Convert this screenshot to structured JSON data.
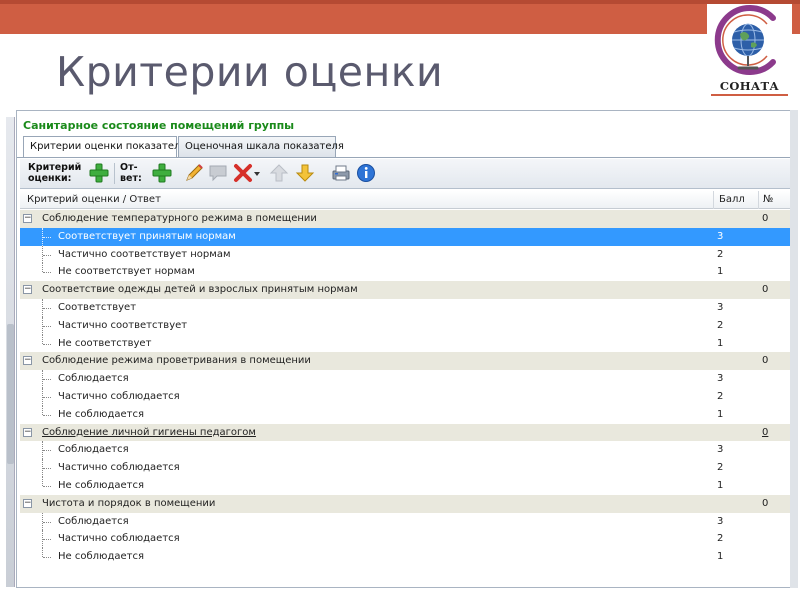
{
  "slide": {
    "title": "Критерии оценки",
    "logo_text": "СОНАТА"
  },
  "window": {
    "title": "Санитарное состояние помещений группы",
    "tabs": [
      {
        "label": "Критерии оценки показателя",
        "active": true
      },
      {
        "label": "Оценочная шкала показателя",
        "active": false
      }
    ]
  },
  "toolbar": {
    "criterion_label_line1": "Критерий",
    "criterion_label_line2": "оценки:",
    "answer_label_line1": "От-",
    "answer_label_line2": "вет:",
    "icons": [
      "add-criterion-icon",
      "add-answer-icon",
      "edit-pencil-icon",
      "comment-icon",
      "delete-icon",
      "dropdown-arrow-icon",
      "move-up-icon",
      "move-down-icon",
      "print-icon",
      "info-icon"
    ]
  },
  "grid": {
    "columns": {
      "criterion": "Критерий оценки / Ответ",
      "score": "Балл",
      "num": "№"
    },
    "groups": [
      {
        "name": "Соблюдение температурного режима в помещении",
        "num": "0",
        "underlined": false,
        "answers": [
          {
            "text": "Соответствует принятым нормам",
            "score": "3",
            "selected": true
          },
          {
            "text": "Частично соответствует нормам",
            "score": "2",
            "selected": false
          },
          {
            "text": "Не соответствует нормам",
            "score": "1",
            "selected": false
          }
        ]
      },
      {
        "name": "Соответствие одежды детей и взрослых принятым нормам",
        "num": "0",
        "underlined": false,
        "answers": [
          {
            "text": "Соответствует",
            "score": "3",
            "selected": false
          },
          {
            "text": "Частично соответствует",
            "score": "2",
            "selected": false
          },
          {
            "text": "Не соответствует",
            "score": "1",
            "selected": false
          }
        ]
      },
      {
        "name": "Соблюдение режима проветривания в помещении",
        "num": "0",
        "underlined": false,
        "answers": [
          {
            "text": "Соблюдается",
            "score": "3",
            "selected": false
          },
          {
            "text": "Частично соблюдается",
            "score": "2",
            "selected": false
          },
          {
            "text": "Не соблюдается",
            "score": "1",
            "selected": false
          }
        ]
      },
      {
        "name": "Соблюдение  личной гигиены педагогом",
        "num": "0",
        "underlined": true,
        "answers": [
          {
            "text": "Соблюдается",
            "score": "3",
            "selected": false
          },
          {
            "text": "Частично соблюдается",
            "score": "2",
            "selected": false
          },
          {
            "text": "Не соблюдается",
            "score": "1",
            "selected": false
          }
        ]
      },
      {
        "name": "Чистота и порядок в помещении",
        "num": "0",
        "underlined": false,
        "answers": [
          {
            "text": "Соблюдается",
            "score": "3",
            "selected": false
          },
          {
            "text": "Частично соблюдается",
            "score": "2",
            "selected": false
          },
          {
            "text": "Не соблюдается",
            "score": "1",
            "selected": false
          }
        ]
      }
    ]
  },
  "colors": {
    "top_bar": "#cf5e43",
    "window_title": "#1a8a1a",
    "group_row": "#e9e8dd",
    "selected_row": "#3399ff"
  }
}
